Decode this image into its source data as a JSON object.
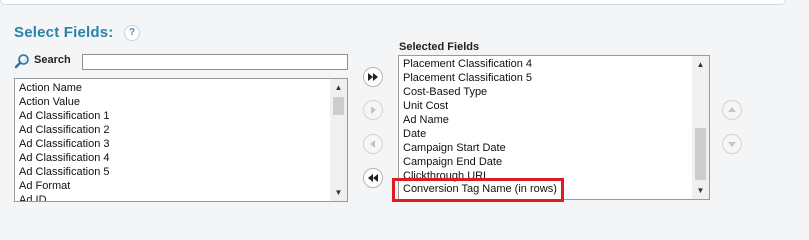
{
  "section": {
    "title": "Select Fields:",
    "help_glyph": "?"
  },
  "search": {
    "label": "Search",
    "value": "",
    "icon": "magnifier-icon"
  },
  "available": {
    "items": [
      "Action Name",
      "Action Value",
      "Ad Classification 1",
      "Ad Classification 2",
      "Ad Classification 3",
      "Ad Classification 4",
      "Ad Classification 5",
      "Ad Format",
      "Ad ID"
    ]
  },
  "selected": {
    "heading": "Selected Fields",
    "items": [
      "Placement Classification 4",
      "Placement Classification 5",
      "Cost-Based Type",
      "Unit Cost",
      "Ad Name",
      "Date",
      "Campaign Start Date",
      "Campaign End Date",
      "Clickthrough URL"
    ],
    "highlighted_item": "Conversion Tag Name (in rows)"
  },
  "buttons": {
    "add_all": "double-right-arrow-icon",
    "add": "right-arrow-icon",
    "remove": "left-arrow-icon",
    "remove_all": "double-left-arrow-icon",
    "move_up": "up-arrow-icon",
    "move_down": "down-arrow-icon"
  },
  "colors": {
    "title": "#2a82a8",
    "highlight": "#e11b22",
    "background": "#f3f5f7"
  }
}
